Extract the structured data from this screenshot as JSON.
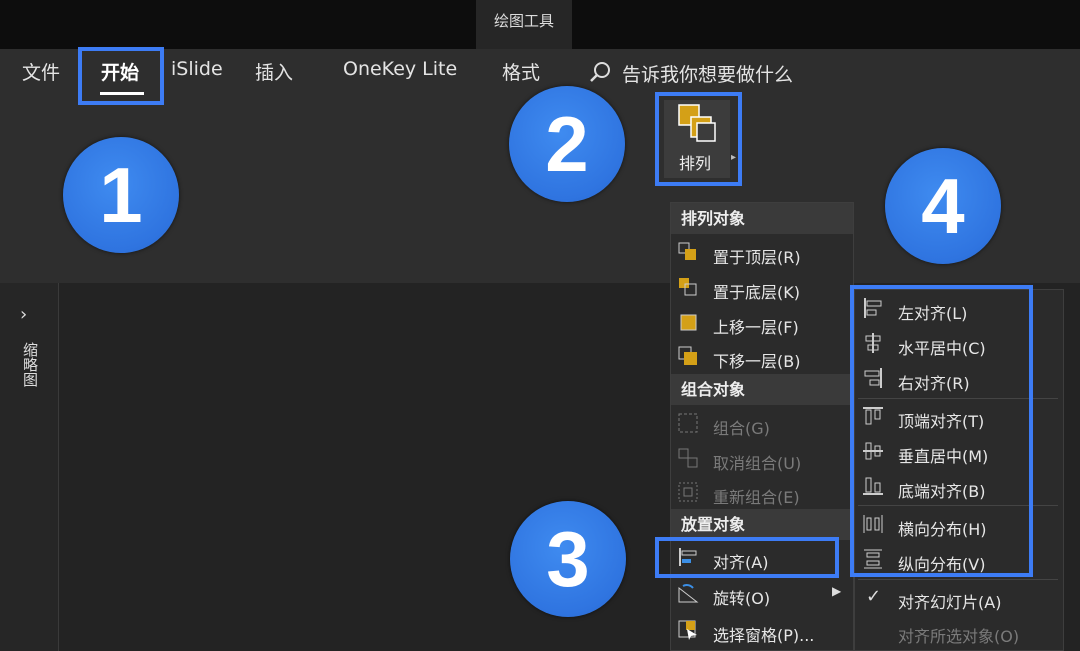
{
  "window": {
    "context_tab": "绘图工具"
  },
  "ribbon": {
    "tabs": [
      "文件",
      "开始",
      "iSlide",
      "插入",
      "OneKey Lite",
      "格式"
    ],
    "search_text": "告诉我你想要做什么",
    "arrange_label": "排列"
  },
  "sidebar": {
    "thumbnail_label": "缩略图"
  },
  "callouts": [
    "1",
    "2",
    "3",
    "4"
  ],
  "arrange_menu": {
    "section1": "排列对象",
    "send_front": "置于顶层(R)",
    "send_back": "置于底层(K)",
    "bring_forward": "上移一层(F)",
    "send_backward": "下移一层(B)",
    "section2": "组合对象",
    "group": "组合(G)",
    "ungroup": "取消组合(U)",
    "regroup": "重新组合(E)",
    "section3": "放置对象",
    "align": "对齐(A)",
    "rotate": "旋转(O)",
    "selection_pane": "选择窗格(P)..."
  },
  "align_menu": {
    "left": "左对齐(L)",
    "center_h": "水平居中(C)",
    "right": "右对齐(R)",
    "top": "顶端对齐(T)",
    "middle_v": "垂直居中(M)",
    "bottom": "底端对齐(B)",
    "distribute_h": "横向分布(H)",
    "distribute_v": "纵向分布(V)",
    "align_slide": "对齐幻灯片(A)",
    "align_selected": "对齐所选对象(O)"
  },
  "colors": {
    "accent": "#3d7cf5",
    "icon_gold": "#d4a017",
    "icon_blue": "#3b8fe6"
  }
}
